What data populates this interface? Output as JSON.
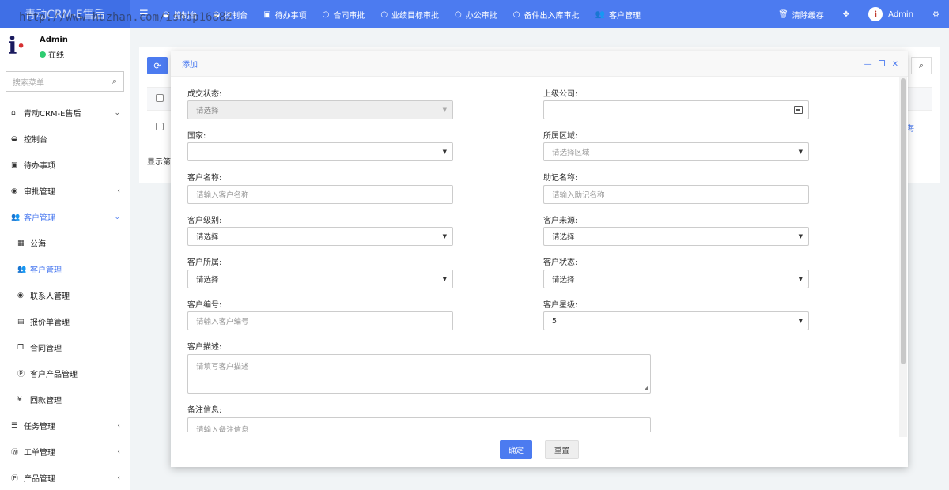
{
  "topbar": {
    "brand": "青动CRM-E售后",
    "nav": [
      {
        "icon": "dashboard-icon",
        "label": "控制台"
      },
      {
        "icon": "dashboard-icon",
        "label": "控制台"
      },
      {
        "icon": "calendar-icon",
        "label": "待办事项"
      },
      {
        "icon": "circle-icon",
        "label": "合同审批"
      },
      {
        "icon": "circle-icon",
        "label": "业绩目标审批"
      },
      {
        "icon": "circle-icon",
        "label": "办公审批"
      },
      {
        "icon": "circle-icon",
        "label": "备件出入库审批"
      },
      {
        "icon": "users-icon",
        "label": "客户管理"
      }
    ],
    "clear_cache": "清除缓存",
    "admin": "Admin"
  },
  "sidebar": {
    "user_name": "Admin",
    "user_status": "在线",
    "watermark": "http://www.huzhan.com/ishop16882",
    "search_placeholder": "搜索菜单",
    "items": [
      {
        "icon": "home-icon",
        "label": "青动CRM-E售后",
        "caret": "⌄"
      },
      {
        "icon": "dashboard-icon",
        "label": "控制台",
        "caret": ""
      },
      {
        "icon": "calendar-icon",
        "label": "待办事项",
        "caret": ""
      },
      {
        "icon": "eye-icon",
        "label": "审批管理",
        "caret": "‹"
      },
      {
        "icon": "users-icon",
        "label": "客户管理",
        "caret": "⌄"
      },
      {
        "icon": "map-icon",
        "label": "公海",
        "caret": ""
      },
      {
        "icon": "users-icon",
        "label": "客户管理",
        "caret": ""
      },
      {
        "icon": "user-circle-icon",
        "label": "联系人管理",
        "caret": ""
      },
      {
        "icon": "file-icon",
        "label": "报价单管理",
        "caret": ""
      },
      {
        "icon": "copy-icon",
        "label": "合同管理",
        "caret": ""
      },
      {
        "icon": "product-icon",
        "label": "客户产品管理",
        "caret": ""
      },
      {
        "icon": "yen-icon",
        "label": "回款管理",
        "caret": ""
      },
      {
        "icon": "list-icon",
        "label": "任务管理",
        "caret": "‹"
      },
      {
        "icon": "wordpress-icon",
        "label": "工单管理",
        "caret": "‹"
      },
      {
        "icon": "product-icon",
        "label": "产品管理",
        "caret": "‹"
      }
    ]
  },
  "background": {
    "footer_text": "显示第",
    "link_text": "海"
  },
  "modal": {
    "title": "添加",
    "fields": {
      "deal_status": {
        "label": "成交状态:",
        "value": "请选择"
      },
      "parent_company": {
        "label": "上级公司:",
        "value": ""
      },
      "country": {
        "label": "国家:",
        "value": ""
      },
      "region": {
        "label": "所属区域:",
        "value": "请选择区域"
      },
      "customer_name": {
        "label": "客户名称:",
        "placeholder": "请输入客户名称"
      },
      "mnemonic_name": {
        "label": "助记名称:",
        "placeholder": "请输入助记名称"
      },
      "customer_level": {
        "label": "客户级别:",
        "value": "请选择"
      },
      "customer_source": {
        "label": "客户来源:",
        "value": "请选择"
      },
      "customer_owner": {
        "label": "客户所属:",
        "value": "请选择"
      },
      "customer_status": {
        "label": "客户状态:",
        "value": "请选择"
      },
      "customer_code": {
        "label": "客户编号:",
        "placeholder": "请输入客户编号"
      },
      "customer_star": {
        "label": "客户星级:",
        "value": "5"
      },
      "customer_desc": {
        "label": "客户描述:",
        "placeholder": "请填写客户描述"
      },
      "remark": {
        "label": "备注信息:",
        "placeholder": "请输入备注信息"
      }
    },
    "confirm_label": "确定",
    "reset_label": "重置"
  }
}
